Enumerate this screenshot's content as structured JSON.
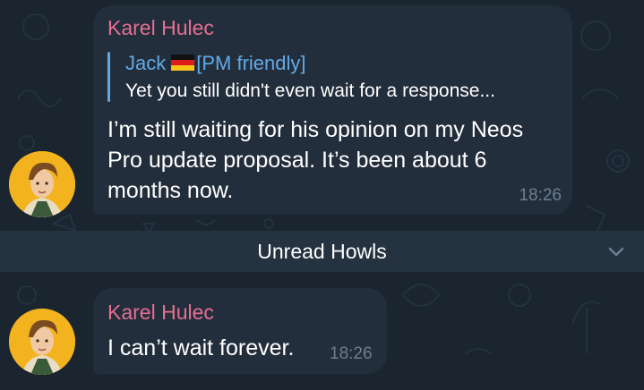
{
  "messages": [
    {
      "sender": "Karel Hulec",
      "reply": {
        "name_prefix": "Jack",
        "name_suffix": "[PM friendly]",
        "flag_icon": "german-flag-icon",
        "text": "Yet you still didn't even wait for a response..."
      },
      "text": "I’m still waiting for his opinion on my Neos Pro update proposal. It’s been about 6 months now.",
      "time": "18:26"
    },
    {
      "sender": "Karel Hulec",
      "text": "I can’t wait forever.",
      "time": "18:26"
    }
  ],
  "unread_divider": {
    "label": "Unread Howls",
    "scroll_icon": "chevron-down-icon"
  },
  "colors": {
    "background": "#1b2530",
    "bubble": "#232e3c",
    "sender_name": "#e66f92",
    "reply_accent": "#63a9e4",
    "timestamp": "#6d7f8f",
    "divider_bar": "#253240",
    "avatar_bg": "#f2b31f"
  }
}
